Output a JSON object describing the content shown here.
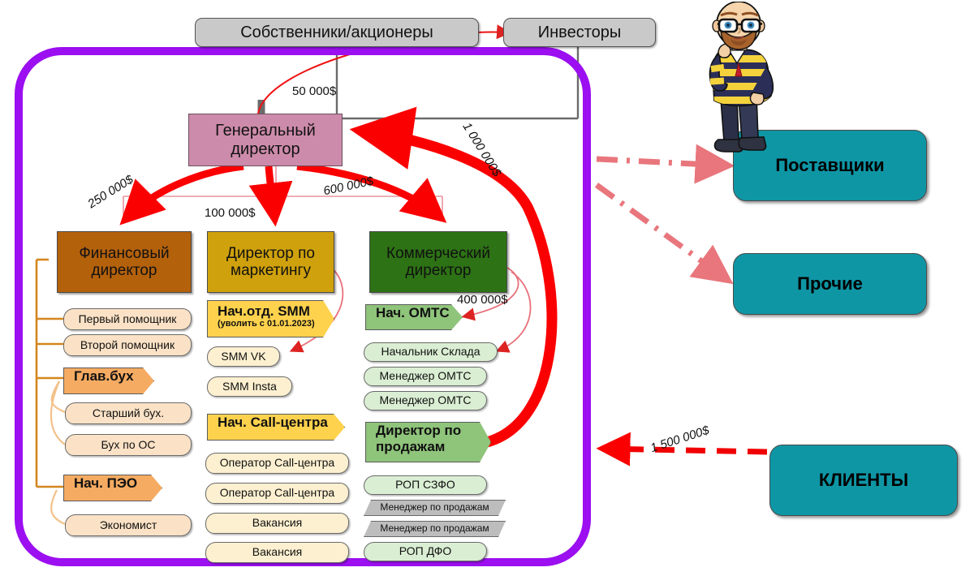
{
  "diagram": {
    "title": "Организационная структура компании с денежными потоками",
    "colors": {
      "boundary": "#9b0ff0",
      "external": "#0f96a5",
      "finance": "#b4610c",
      "marketing": "#cfa10c",
      "commercial": "#2d7215",
      "general": "#cd8bab",
      "money_flow_thick": "#ff0000",
      "money_flow_thin": "#e8707a"
    }
  },
  "top_nodes": [
    {
      "id": "owners",
      "label": "Собственники/акционеры"
    },
    {
      "id": "investors",
      "label": "Инвесторы"
    }
  ],
  "general_director": {
    "label": "Генеральный директор"
  },
  "directors": [
    {
      "id": "fin",
      "label": "Финансовый директор",
      "color": "#b4610c"
    },
    {
      "id": "mkt",
      "label": "Директор по маркетингу",
      "color": "#cfa10c"
    },
    {
      "id": "com",
      "label": "Коммерческий директор",
      "color": "#2d7215"
    }
  ],
  "finance_branch": [
    {
      "label": "Первый помощник",
      "kind": "pill-cream2"
    },
    {
      "label": "Второй помощник",
      "kind": "pill-cream2"
    },
    {
      "label": "Глав.бух",
      "kind": "head-orange"
    },
    {
      "label": "Старший бух.",
      "kind": "pill-cream2"
    },
    {
      "label": "Бух по ОС",
      "kind": "pill-cream2"
    },
    {
      "label": "Нач. ПЭО",
      "kind": "head-orange"
    },
    {
      "label": "Экономист",
      "kind": "pill-cream2"
    }
  ],
  "marketing_branch": [
    {
      "label": "Нач.отд. SMM",
      "sublabel": "(уволить с  01.01.2023)",
      "kind": "head-yellow"
    },
    {
      "label": "SMM VK",
      "kind": "pill-cream"
    },
    {
      "label": "SMM Insta",
      "kind": "pill-cream"
    },
    {
      "label": "Нач. Call-центра",
      "kind": "head-yellow"
    },
    {
      "label": "Оператор Call-центра",
      "kind": "pill-cream"
    },
    {
      "label": "Оператор Call-центра",
      "kind": "pill-cream"
    },
    {
      "label": "Вакансия",
      "kind": "pill-cream"
    },
    {
      "label": "Вакансия",
      "kind": "pill-cream"
    }
  ],
  "commercial_branch": [
    {
      "label": "Нач. ОМТС",
      "kind": "head-green"
    },
    {
      "label": "Начальник Склада",
      "kind": "pill-green"
    },
    {
      "label": "Менеджер ОМТС",
      "kind": "pill-green"
    },
    {
      "label": "Менеджер ОМТС",
      "kind": "pill-green"
    },
    {
      "label": "Директор по продажам",
      "kind": "head-green"
    },
    {
      "label": "РОП СЗФО",
      "kind": "pill-green"
    },
    {
      "label": "Менеджер по продажам",
      "kind": "slant-gray"
    },
    {
      "label": "Менеджер по продажам",
      "kind": "slant-gray"
    },
    {
      "label": "РОП ДФО",
      "kind": "pill-green"
    }
  ],
  "external_nodes": [
    {
      "id": "suppliers",
      "label": "Поставщики"
    },
    {
      "id": "other",
      "label": "Прочие"
    },
    {
      "id": "clients",
      "label": "КЛИЕНТЫ"
    }
  ],
  "money_labels": [
    {
      "id": "m50",
      "value": "50 000$",
      "rotate": 0
    },
    {
      "id": "m250",
      "value": "250 000$",
      "rotate": -32
    },
    {
      "id": "m100",
      "value": "100 000$",
      "rotate": 0
    },
    {
      "id": "m600",
      "value": "600 000$",
      "rotate": -12
    },
    {
      "id": "m1000",
      "value": "1 000 000$",
      "rotate": 58
    },
    {
      "id": "m400",
      "value": "400 000$",
      "rotate": 0
    },
    {
      "id": "m1500",
      "value": "1 500 000$",
      "rotate": -18
    }
  ],
  "avatar": {
    "name": "cartoon-man-sitting-avatar"
  }
}
